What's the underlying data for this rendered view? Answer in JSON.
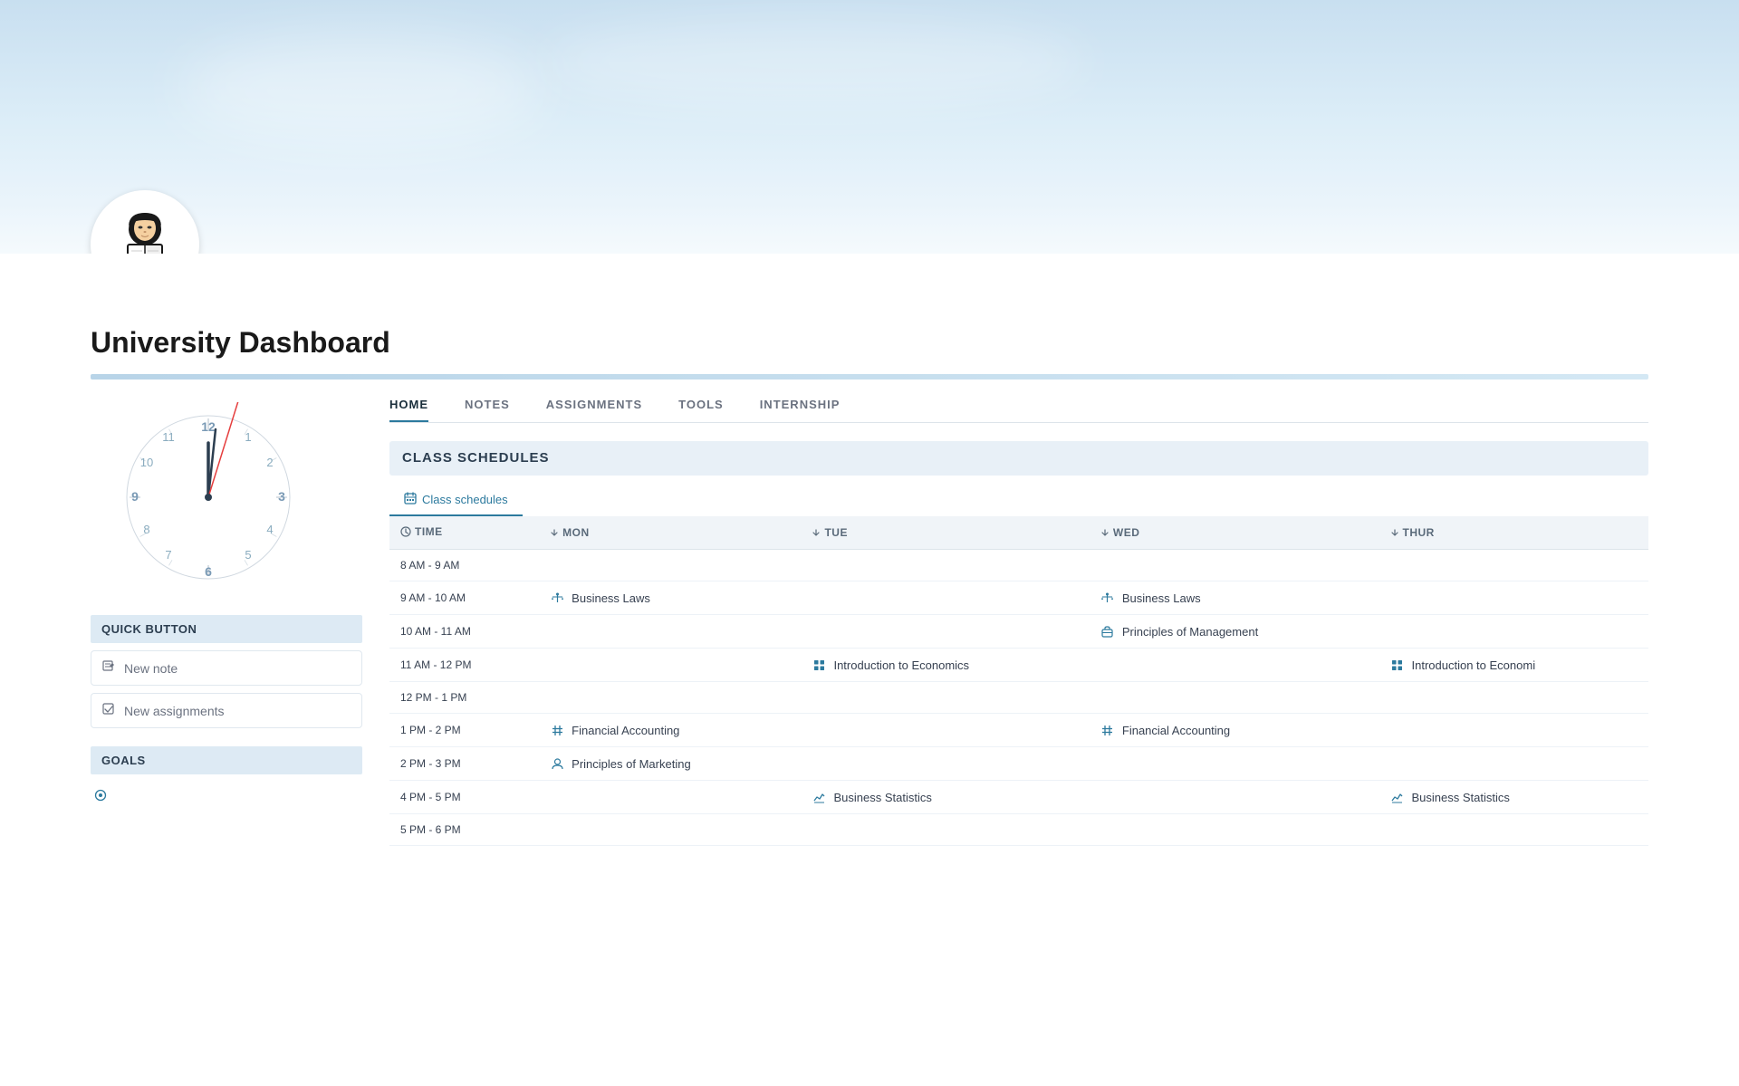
{
  "hero": {
    "alt": "University Dashboard Banner"
  },
  "title": "University Dashboard",
  "tabs": [
    {
      "id": "home",
      "label": "HOME",
      "active": true
    },
    {
      "id": "notes",
      "label": "NOTES",
      "active": false
    },
    {
      "id": "assignments",
      "label": "ASSIGNMENTS",
      "active": false
    },
    {
      "id": "tools",
      "label": "TOOLS",
      "active": false
    },
    {
      "id": "internship",
      "label": "INTERNSHIP",
      "active": false
    }
  ],
  "section": {
    "class_schedules": "CLASS SCHEDULES",
    "schedule_tab": "Class schedules",
    "quick_button": "QUICK BUTTON",
    "goals": "GOALS"
  },
  "quick_buttons": [
    {
      "id": "new-note",
      "label": "New note",
      "icon": "edit"
    },
    {
      "id": "new-assignments",
      "label": "New assignments",
      "icon": "check"
    }
  ],
  "table": {
    "columns": [
      "TIME",
      "MON",
      "TUE",
      "WED",
      "THUR"
    ],
    "rows": [
      {
        "time": "8 AM - 9 AM",
        "mon": null,
        "tue": null,
        "wed": null,
        "thur": null
      },
      {
        "time": "9 AM - 10 AM",
        "mon": {
          "label": "Business Laws",
          "icon": "balance"
        },
        "tue": null,
        "wed": {
          "label": "Business Laws",
          "icon": "balance"
        },
        "thur": null
      },
      {
        "time": "10 AM - 11 AM",
        "mon": null,
        "tue": null,
        "wed": {
          "label": "Principles of Management",
          "icon": "briefcase"
        },
        "thur": null
      },
      {
        "time": "11 AM - 12 PM",
        "mon": null,
        "tue": {
          "label": "Introduction to Economics",
          "icon": "grid"
        },
        "wed": null,
        "thur": {
          "label": "Introduction to Economi",
          "icon": "grid"
        }
      },
      {
        "time": "12 PM - 1 PM",
        "mon": null,
        "tue": null,
        "wed": null,
        "thur": null
      },
      {
        "time": "1 PM - 2 PM",
        "mon": {
          "label": "Financial Accounting",
          "icon": "hash"
        },
        "tue": null,
        "wed": {
          "label": "Financial Accounting",
          "icon": "hash"
        },
        "thur": null
      },
      {
        "time": "2 PM - 3 PM",
        "mon": {
          "label": "Principles of Marketing",
          "icon": "user"
        },
        "tue": null,
        "wed": null,
        "thur": null
      },
      {
        "time": "4 PM - 5 PM",
        "mon": null,
        "tue": {
          "label": "Business Statistics",
          "icon": "chart"
        },
        "wed": null,
        "thur": {
          "label": "Business Statistics",
          "icon": "chart"
        }
      },
      {
        "time": "5 PM - 6 PM",
        "mon": null,
        "tue": null,
        "wed": null,
        "thur": null
      }
    ]
  }
}
